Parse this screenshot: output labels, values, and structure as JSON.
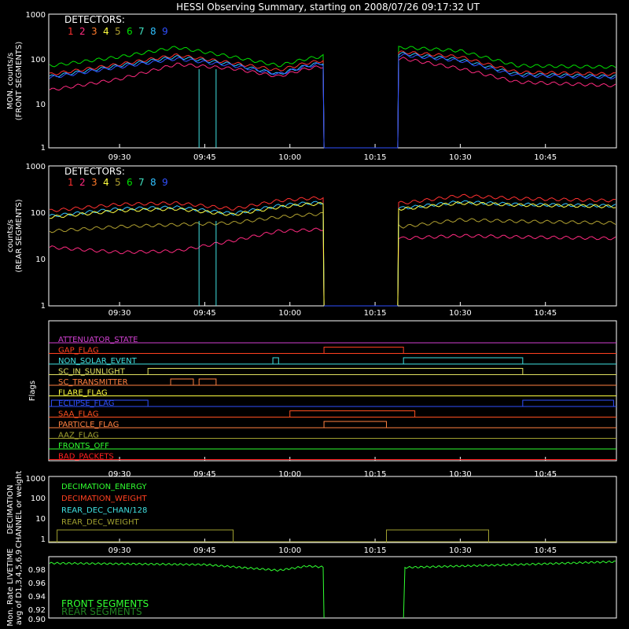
{
  "title": "HESSI Observing Summary, starting on 2008/07/26 09:17:32 UT",
  "time_ticks": [
    "09:30",
    "09:45",
    "10:00",
    "10:15",
    "10:30",
    "10:45"
  ],
  "detectors_label": "DETECTORS:",
  "detectors": [
    {
      "n": "1",
      "color": "#ff3030"
    },
    {
      "n": "2",
      "color": "#ff2a7f"
    },
    {
      "n": "3",
      "color": "#ff7a2a"
    },
    {
      "n": "4",
      "color": "#ffff40"
    },
    {
      "n": "5",
      "color": "#b0a030"
    },
    {
      "n": "6",
      "color": "#00e000"
    },
    {
      "n": "7",
      "color": "#40e0c0"
    },
    {
      "n": "8",
      "color": "#30c0ff"
    },
    {
      "n": "9",
      "color": "#3050ff"
    }
  ],
  "panel1": {
    "ylabel1": "MON. counts/s",
    "ylabel2": "(FRONT SEGMENTS)"
  },
  "panel2": {
    "ylabel1": "counts/s",
    "ylabel2": "(REAR SEGMENTS)"
  },
  "panel3": {
    "ylabel": "Flags"
  },
  "panel4": {
    "ylabel1": "DECIMATION",
    "ylabel2": "CHANNEL or weight"
  },
  "panel5": {
    "ylabel1": "Mon. Rate LIVETIME",
    "ylabel2": "avg of D1,3,4,5,6,9"
  },
  "log_ticks": [
    "1000",
    "100",
    "10",
    "1"
  ],
  "livetime_ticks": [
    "0.98",
    "0.96",
    "0.94",
    "0.92",
    "0.90"
  ],
  "flags": [
    {
      "label": "ATTENUATOR_STATE",
      "color": "#d040d0"
    },
    {
      "label": "GAP_FLAG",
      "color": "#ff4020"
    },
    {
      "label": "NON_SOLAR_EVENT",
      "color": "#40e0e0"
    },
    {
      "label": "SC_IN_SUNLIGHT",
      "color": "#e0e060"
    },
    {
      "label": "SC_TRANSMITTER",
      "color": "#ff8040"
    },
    {
      "label": "FLARE_FLAG",
      "color": "#ffff40"
    },
    {
      "label": "ECLIPSE_FLAG",
      "color": "#3050ff"
    },
    {
      "label": "SAA_FLAG",
      "color": "#ff5020"
    },
    {
      "label": "PARTICLE_FLAG",
      "color": "#ff8040"
    },
    {
      "label": "AAZ_FLAG",
      "color": "#a0a030"
    },
    {
      "label": "FRONTS_OFF",
      "color": "#30ff30"
    },
    {
      "label": "BAD_PACKETS",
      "color": "#ff2020"
    }
  ],
  "decimation_legend": [
    {
      "label": "DECIMATION_ENERGY",
      "color": "#30ff30"
    },
    {
      "label": "DECIMATION_WEIGHT",
      "color": "#ff4020"
    },
    {
      "label": "REAR_DEC_CHAN/128",
      "color": "#40e0e0"
    },
    {
      "label": "REAR_DEC_WEIGHT",
      "color": "#a0a030"
    }
  ],
  "livetime_legend": [
    {
      "label": "FRONT SEGMENTS",
      "color": "#30ff30"
    },
    {
      "label": "REAR SEGMENTS",
      "color": "#208020"
    }
  ],
  "chart_data": [
    {
      "type": "line",
      "panel": "front",
      "ylog": true,
      "ylim": [
        1,
        1000
      ],
      "xlim": [
        "09:17:32",
        "10:57:30"
      ],
      "series": [
        {
          "name": "6",
          "color": "#00e000",
          "x": [
            "09:18",
            "09:30",
            "09:40",
            "09:50",
            "09:58",
            "10:03",
            "10:07",
            "10:20",
            "10:30",
            "10:40",
            "10:57"
          ],
          "values": [
            70,
            110,
            180,
            110,
            70,
            100,
            120,
            180,
            150,
            70,
            65
          ]
        },
        {
          "name": "1",
          "color": "#ff3030",
          "x": [
            "09:18",
            "09:30",
            "09:40",
            "09:50",
            "09:58",
            "10:03",
            "10:07",
            "10:20",
            "10:30",
            "10:40",
            "10:57"
          ],
          "values": [
            45,
            75,
            120,
            80,
            55,
            80,
            95,
            140,
            110,
            50,
            45
          ]
        },
        {
          "name": "2",
          "color": "#ff2a7f",
          "x": [
            "09:18",
            "09:30",
            "09:40",
            "09:50",
            "09:58",
            "10:03",
            "10:07",
            "10:20",
            "10:30",
            "10:40",
            "10:57"
          ],
          "values": [
            20,
            35,
            75,
            60,
            40,
            60,
            70,
            100,
            60,
            30,
            25
          ]
        },
        {
          "name": "8",
          "color": "#30c0ff",
          "x": [
            "09:18",
            "09:30",
            "09:40",
            "09:50",
            "09:58",
            "10:03",
            "10:07",
            "10:20",
            "10:30",
            "10:40",
            "10:57"
          ],
          "values": [
            40,
            70,
            110,
            75,
            45,
            70,
            85,
            130,
            95,
            45,
            40
          ]
        },
        {
          "name": "9",
          "color": "#3050ff",
          "x": [
            "09:18",
            "09:30",
            "09:40",
            "09:50",
            "09:58",
            "10:03",
            "10:07",
            "10:20",
            "10:30",
            "10:40",
            "10:57"
          ],
          "values": [
            38,
            65,
            100,
            70,
            45,
            68,
            80,
            120,
            90,
            42,
            38
          ]
        }
      ]
    },
    {
      "type": "line",
      "panel": "rear",
      "ylog": true,
      "ylim": [
        1,
        1000
      ],
      "xlim": [
        "09:17:32",
        "10:57:30"
      ],
      "series": [
        {
          "name": "1",
          "color": "#ff3030",
          "x": [
            "09:18",
            "09:30",
            "09:40",
            "09:50",
            "09:58",
            "10:03",
            "10:07",
            "10:20",
            "10:30",
            "10:40",
            "10:57"
          ],
          "values": [
            110,
            150,
            160,
            120,
            180,
            200,
            210,
            160,
            230,
            200,
            180
          ]
        },
        {
          "name": "2",
          "color": "#ff2a7f",
          "x": [
            "09:18",
            "09:30",
            "09:40",
            "09:50",
            "09:58",
            "10:03",
            "10:07",
            "10:20",
            "10:30",
            "10:40",
            "10:57"
          ],
          "values": [
            18,
            14,
            15,
            25,
            40,
            42,
            45,
            28,
            32,
            30,
            28
          ]
        },
        {
          "name": "5",
          "color": "#b0a030",
          "x": [
            "09:18",
            "09:30",
            "09:40",
            "09:50",
            "09:58",
            "10:03",
            "10:07",
            "10:20",
            "10:30",
            "10:40",
            "10:57"
          ],
          "values": [
            40,
            50,
            55,
            60,
            80,
            90,
            95,
            50,
            70,
            65,
            60
          ]
        },
        {
          "name": "8",
          "color": "#30c0ff",
          "x": [
            "09:18",
            "09:30",
            "09:40",
            "09:50",
            "09:58",
            "10:03",
            "10:07",
            "10:20",
            "10:30",
            "10:40",
            "10:57"
          ],
          "values": [
            85,
            120,
            130,
            95,
            140,
            160,
            165,
            125,
            170,
            150,
            140
          ]
        },
        {
          "name": "4",
          "color": "#ffff40",
          "x": [
            "09:18",
            "09:30",
            "09:40",
            "09:50",
            "09:58",
            "10:03",
            "10:07",
            "10:20",
            "10:30",
            "10:40",
            "10:57"
          ],
          "values": [
            80,
            110,
            120,
            90,
            130,
            150,
            155,
            120,
            160,
            145,
            135
          ]
        }
      ]
    },
    {
      "type": "line",
      "panel": "livetime",
      "ylim": [
        0.9,
        0.985
      ],
      "series": [
        {
          "name": "FRONT SEGMENTS",
          "color": "#30ff30",
          "x": [
            "09:18",
            "09:45",
            "09:58",
            "10:03",
            "10:07",
            "10:20",
            "10:40",
            "10:57"
          ],
          "values": [
            0.976,
            0.974,
            0.966,
            0.972,
            0.97,
            0.97,
            0.974,
            0.978
          ]
        }
      ]
    }
  ]
}
